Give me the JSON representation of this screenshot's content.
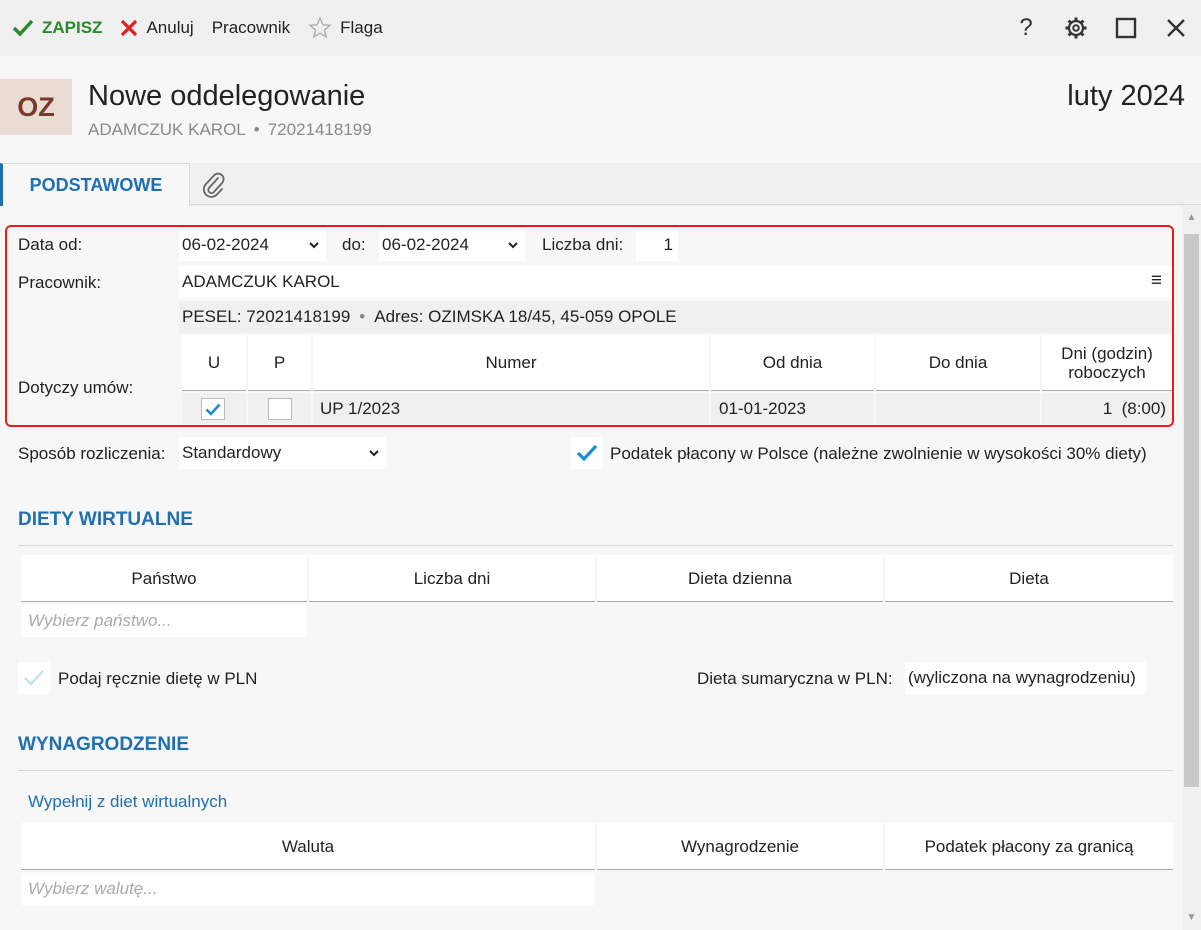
{
  "toolbar": {
    "save": "ZAPISZ",
    "cancel": "Anuluj",
    "employee": "Pracownik",
    "flag": "Flaga",
    "help": "?"
  },
  "header": {
    "avatar": "OZ",
    "title": "Nowe oddelegowanie",
    "employee_name": "ADAMCZUK KAROL",
    "pesel": "72021418199",
    "period": "luty 2024"
  },
  "tabs": {
    "basic": "PODSTAWOWE"
  },
  "form": {
    "date_from_label": "Data od:",
    "date_from": "06-02-2024",
    "to_label": "do:",
    "date_to": "06-02-2024",
    "days_label": "Liczba dni:",
    "days": "1",
    "employee_label": "Pracownik:",
    "employee": "ADAMCZUK KAROL",
    "menu_glyph": "≡",
    "pesel_label": "PESEL:",
    "pesel": "72021418199",
    "address_label": "Adres:",
    "address": "OZIMSKA 18/45, 45-059 OPOLE",
    "contracts_label": "Dotyczy umów:",
    "contracts_headers": [
      "U",
      "P",
      "Numer",
      "Od dnia",
      "Do dnia",
      "Dni (godzin) roboczych"
    ],
    "contracts_rows": [
      {
        "u": true,
        "p": false,
        "number": "UP 1/2023",
        "from": "01-01-2023",
        "to": "",
        "days": "1  (8:00)"
      }
    ],
    "settlement_label": "Sposób rozliczenia:",
    "settlement": "Standardowy",
    "tax_poland_label": "Podatek płacony w Polsce (należne zwolnienie w wysokości 30% diety)",
    "tax_poland_checked": true
  },
  "virtual_diets": {
    "title": "DIETY WIRTUALNE",
    "headers": [
      "Państwo",
      "Liczba dni",
      "Dieta dzienna",
      "Dieta"
    ],
    "country_placeholder": "Wybierz państwo...",
    "manual_label": "Podaj ręcznie dietę w PLN",
    "manual_checked": false,
    "sum_label": "Dieta sumaryczna w PLN:",
    "sum_value": "(wyliczona na wynagrodzeniu)"
  },
  "salary": {
    "title": "WYNAGRODZENIE",
    "fill_link": "Wypełnij z diet wirtualnych",
    "headers": [
      "Waluta",
      "Wynagrodzenie",
      "Podatek płacony za granicą"
    ],
    "currency_placeholder": "Wybierz walutę..."
  },
  "colors": {
    "accent": "#1f6fb2",
    "save_green": "#2a8a2a",
    "cancel_red": "#e21e1e",
    "highlight": "#e21e1e"
  }
}
